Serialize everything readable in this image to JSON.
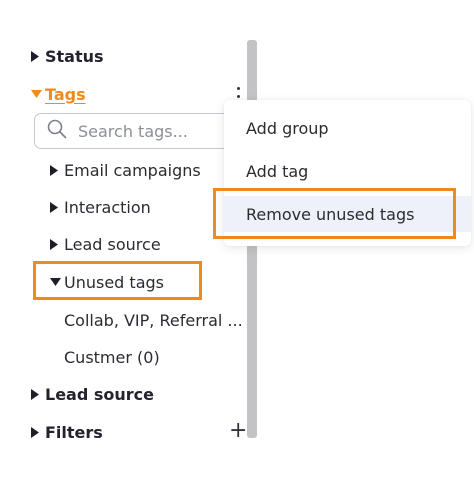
{
  "tree": {
    "status_label": "Status",
    "tags_label": "Tags",
    "search": {
      "placeholder": "Search tags..."
    },
    "tag_groups": [
      {
        "label": "Email campaigns",
        "expanded": false
      },
      {
        "label": "Interaction",
        "expanded": false
      },
      {
        "label": "Lead source",
        "expanded": false
      },
      {
        "label": "Unused tags",
        "expanded": true,
        "children": [
          "Collab, VIP, Referral ...",
          "Custmer (0)"
        ]
      }
    ],
    "lead_source_label": "Lead source",
    "filters_label": "Filters"
  },
  "context_menu": {
    "items": [
      "Add group",
      "Add tag",
      "Remove unused tags"
    ]
  },
  "colors": {
    "accent": "#f08a1c",
    "text": "#2b2b33",
    "scrollbar": "#c3c3c6",
    "menu_hover": "#eef1f7"
  },
  "icons": [
    "caret-right-icon",
    "caret-down-icon",
    "search-icon",
    "kebab-menu-icon",
    "plus-icon"
  ]
}
